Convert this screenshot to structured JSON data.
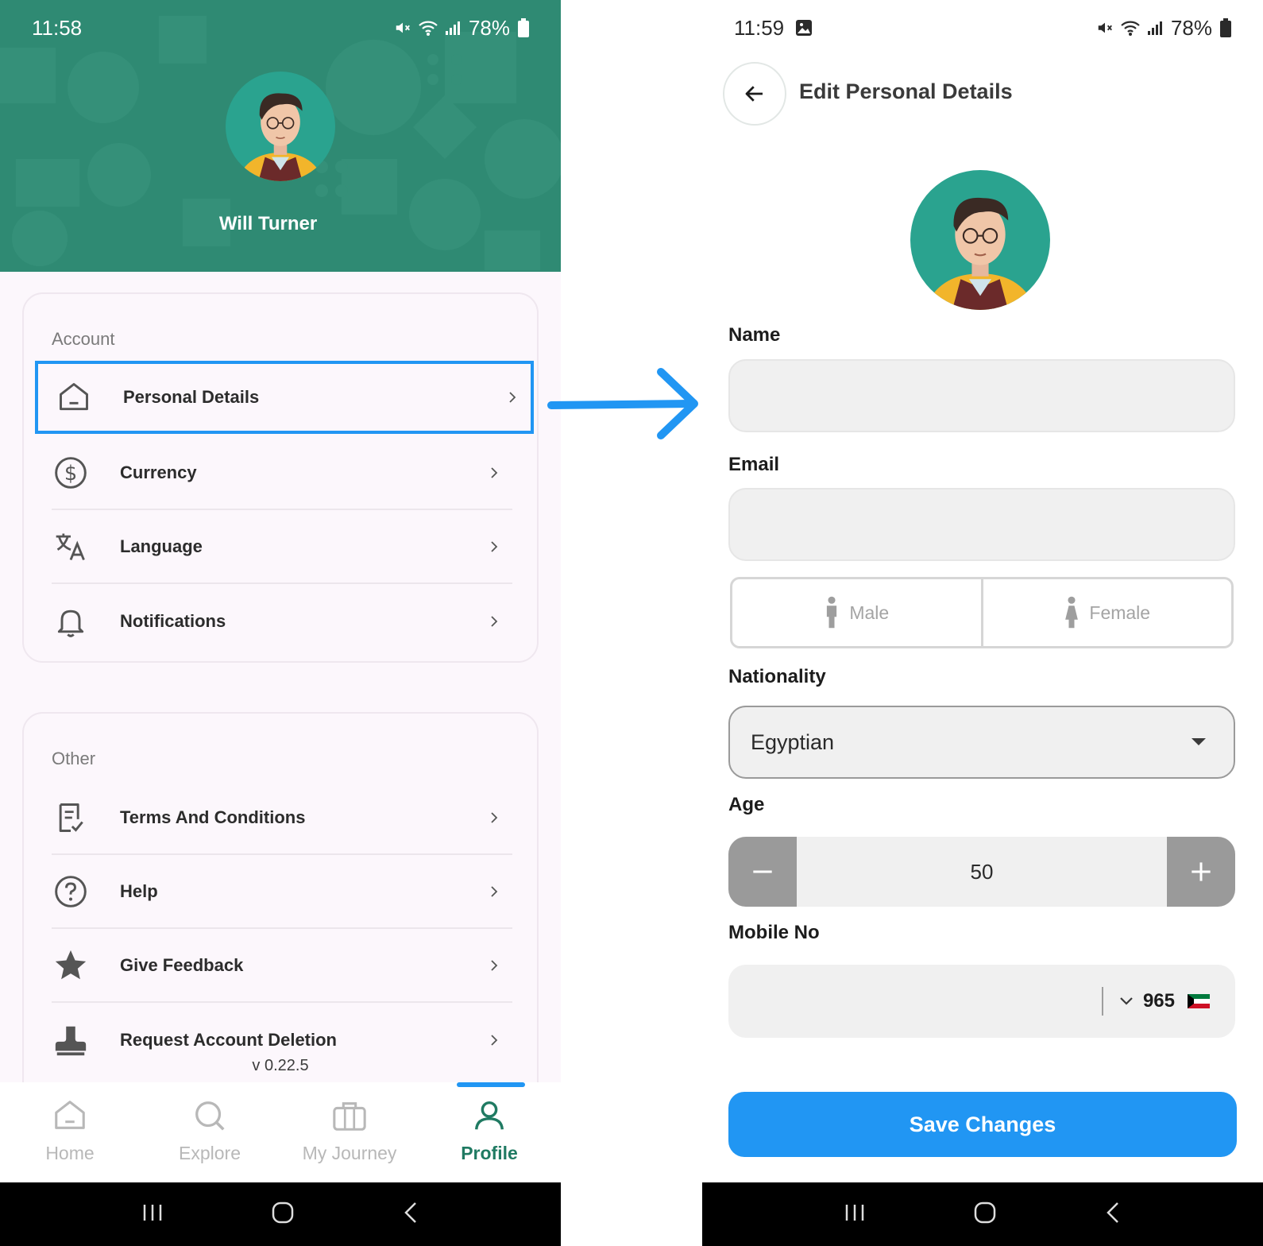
{
  "left_screen": {
    "status": {
      "time": "11:58",
      "battery": "78%"
    },
    "profile": {
      "name": "Will Turner"
    },
    "account": {
      "title": "Account",
      "items": [
        {
          "label": "Personal Details",
          "icon": "home-icon",
          "highlighted": true
        },
        {
          "label": "Currency",
          "icon": "dollar-circle-icon"
        },
        {
          "label": "Language",
          "icon": "translate-icon"
        },
        {
          "label": "Notifications",
          "icon": "bell-icon"
        }
      ]
    },
    "other": {
      "title": "Other",
      "items": [
        {
          "label": "Terms And Conditions",
          "icon": "document-check-icon"
        },
        {
          "label": "Help",
          "icon": "question-circle-icon"
        },
        {
          "label": "Give Feedback",
          "icon": "star-icon"
        },
        {
          "label": "Request Account Deletion",
          "icon": "user-icon"
        }
      ]
    },
    "version": "v 0.22.5",
    "bottom_nav": [
      {
        "label": "Home",
        "icon": "home-icon"
      },
      {
        "label": "Explore",
        "icon": "search-icon"
      },
      {
        "label": "My Journey",
        "icon": "briefcase-icon"
      },
      {
        "label": "Profile",
        "icon": "user-icon",
        "active": true
      }
    ]
  },
  "right_screen": {
    "status": {
      "time": "11:59",
      "battery": "78%"
    },
    "title": "Edit Personal Details",
    "fields": {
      "name": {
        "label": "Name",
        "value": ""
      },
      "email": {
        "label": "Email",
        "value": ""
      },
      "gender": {
        "options": [
          "Male",
          "Female"
        ]
      },
      "nationality": {
        "label": "Nationality",
        "value": "Egyptian"
      },
      "age": {
        "label": "Age",
        "value": "50"
      },
      "mobile": {
        "label": "Mobile No",
        "value": "",
        "country_code": "965",
        "flag": "kuwait-flag"
      }
    },
    "save_button": "Save Changes"
  },
  "colors": {
    "header_green": "#2f8a73",
    "active_nav": "#1f7a62",
    "accent_blue": "#2196f3",
    "card_bg": "#fcf7fc"
  }
}
